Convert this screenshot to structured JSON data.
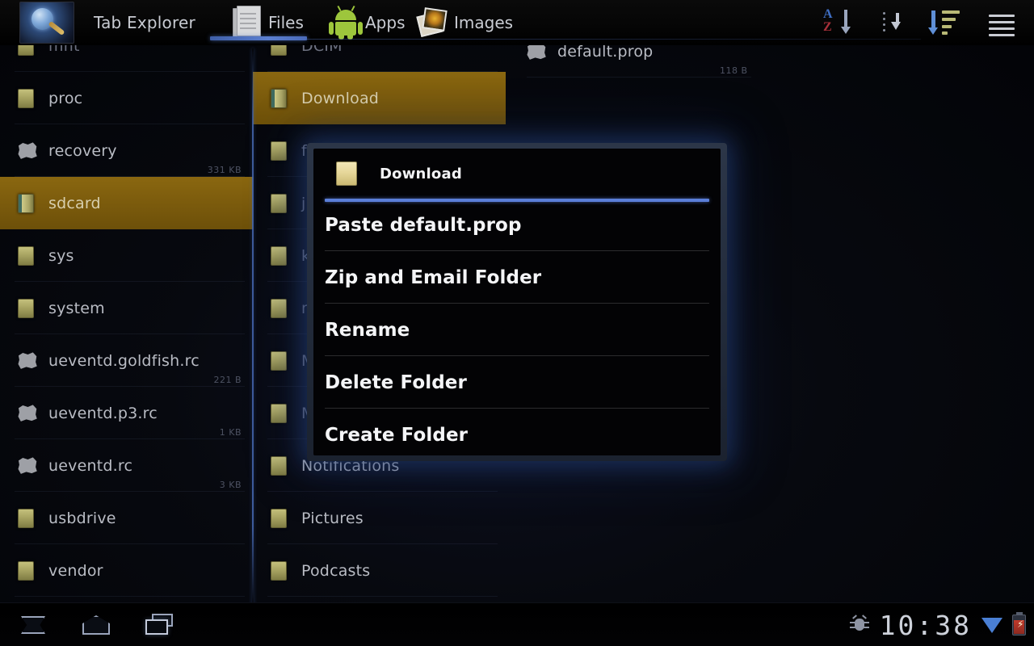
{
  "app": {
    "title": "Tab Explorer",
    "logo_icon": "globe-magnifier-icon"
  },
  "tabs": [
    {
      "id": "files",
      "label": "Files",
      "icon": "documents-icon",
      "active": true
    },
    {
      "id": "apps",
      "label": "Apps",
      "icon": "android-robot-icon",
      "active": false
    },
    {
      "id": "images",
      "label": "Images",
      "icon": "photos-icon",
      "active": false
    }
  ],
  "toolbar": {
    "sort_az_icon": "sort-alphabetical-icon",
    "download_icon": "download-dotted-arrow-icon",
    "sort_list_icon": "sort-list-descending-icon",
    "menu_icon": "hamburger-menu-icon"
  },
  "colors": {
    "accent_blue": "#5a7ed8",
    "selection_gold": "#7a5a0c",
    "folder_olive": "#a8a462",
    "divider_blue": "#4669b4",
    "battery_red": "#c0392b"
  },
  "sidebar": {
    "items": [
      {
        "name": "mnt",
        "type": "folder",
        "size": "",
        "selected": false,
        "dim": true
      },
      {
        "name": "proc",
        "type": "folder",
        "size": "",
        "selected": false,
        "dim": false
      },
      {
        "name": "recovery",
        "type": "file",
        "size": "331 KB",
        "selected": false,
        "dim": false
      },
      {
        "name": "sdcard",
        "type": "folder-open",
        "size": "",
        "selected": true,
        "dim": false
      },
      {
        "name": "sys",
        "type": "folder",
        "size": "",
        "selected": false,
        "dim": false
      },
      {
        "name": "system",
        "type": "folder",
        "size": "",
        "selected": false,
        "dim": false
      },
      {
        "name": "ueventd.goldfish.rc",
        "type": "file",
        "size": "221 B",
        "selected": false,
        "dim": false
      },
      {
        "name": "ueventd.p3.rc",
        "type": "file",
        "size": "1 KB",
        "selected": false,
        "dim": false
      },
      {
        "name": "ueventd.rc",
        "type": "file",
        "size": "3 KB",
        "selected": false,
        "dim": false
      },
      {
        "name": "usbdrive",
        "type": "folder",
        "size": "",
        "selected": false,
        "dim": false
      },
      {
        "name": "vendor",
        "type": "folder",
        "size": "",
        "selected": false,
        "dim": false
      }
    ]
  },
  "middle_column": {
    "items": [
      {
        "name": "DCIM",
        "type": "folder",
        "selected": false,
        "dim": true
      },
      {
        "name": "Download",
        "type": "folder-open",
        "selected": true,
        "dim": false
      },
      {
        "name": "f",
        "type": "folder",
        "selected": false,
        "dim": true
      },
      {
        "name": "j",
        "type": "folder",
        "selected": false,
        "dim": true
      },
      {
        "name": "k",
        "type": "folder",
        "selected": false,
        "dim": true
      },
      {
        "name": "r",
        "type": "folder",
        "selected": false,
        "dim": true
      },
      {
        "name": "M",
        "type": "folder",
        "selected": false,
        "dim": true
      },
      {
        "name": "M",
        "type": "folder",
        "selected": false,
        "dim": true
      },
      {
        "name": "Notifications",
        "type": "folder",
        "selected": false,
        "dim": false
      },
      {
        "name": "Pictures",
        "type": "folder",
        "selected": false,
        "dim": false
      },
      {
        "name": "Podcasts",
        "type": "folder",
        "selected": false,
        "dim": false
      }
    ]
  },
  "right_column": {
    "items": [
      {
        "name": "default.prop",
        "type": "file",
        "size": "118 B",
        "selected": false,
        "dim": false
      }
    ]
  },
  "dialog": {
    "header_title": "Download",
    "header_icon": "folder-icon",
    "menu_items": [
      {
        "label": "Paste default.prop"
      },
      {
        "label": "Zip and Email Folder"
      },
      {
        "label": "Rename"
      },
      {
        "label": "Delete Folder"
      },
      {
        "label": "Create Folder"
      }
    ]
  },
  "system_bar": {
    "back_icon": "back-arrow-icon",
    "home_icon": "home-icon",
    "recents_icon": "recent-apps-icon",
    "usb_debug_icon": "android-debug-icon",
    "clock": "10:38",
    "wifi_icon": "wifi-icon",
    "battery_icon": "battery-charging-icon"
  }
}
